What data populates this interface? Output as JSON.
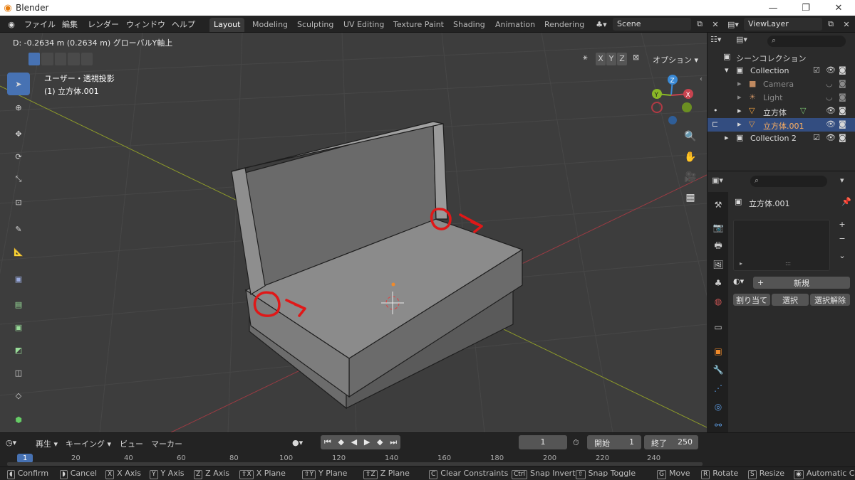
{
  "window": {
    "title": "Blender",
    "minimize": "—",
    "maximize": "❐",
    "close": "✕"
  },
  "menu": [
    "ファイル",
    "編集",
    "レンダー",
    "ウィンドウ",
    "ヘルプ"
  ],
  "workspaces": [
    "Layout",
    "Modeling",
    "Sculpting",
    "UV Editing",
    "Texture Paint",
    "Shading",
    "Animation",
    "Rendering"
  ],
  "active_workspace": "Layout",
  "scene": {
    "name": "Scene",
    "viewlayer": "ViewLayer"
  },
  "viewport": {
    "header_text": "D: -0.2634 m (0.2634 m) グローバルY軸上",
    "view_label": "ユーザー・透視投影",
    "object_label": "(1) 立方体.001",
    "axes": [
      "X",
      "Y",
      "Z"
    ],
    "options_label": "オプション"
  },
  "outliner": {
    "title": "シーンコレクション",
    "items": [
      {
        "label": "Collection",
        "level": 1,
        "icon": "collection-icon"
      },
      {
        "label": "Camera",
        "level": 2,
        "icon": "camera-icon",
        "dim": true
      },
      {
        "label": "Light",
        "level": 2,
        "icon": "light-icon",
        "dim": true
      },
      {
        "label": "立方体",
        "level": 2,
        "icon": "mesh-icon"
      },
      {
        "label": "立方体.001",
        "level": 2,
        "icon": "mesh-icon",
        "selected": true
      },
      {
        "label": "Collection 2",
        "level": 1,
        "icon": "collection-icon"
      }
    ]
  },
  "properties": {
    "object_name": "立方体.001",
    "new_label": "新規",
    "assign_label": "割り当て",
    "select_label": "選択",
    "deselect_label": "選択解除",
    "add_glyph": "+",
    "remove_glyph": "−",
    "dots": ":::"
  },
  "timeline": {
    "playback": "再生",
    "keying": "キーイング",
    "view": "ビュー",
    "marker": "マーカー",
    "current_frame": "1",
    "start_label": "開始",
    "start": "1",
    "end_label": "終了",
    "end": "250",
    "ticks": [
      "1",
      "20",
      "40",
      "60",
      "80",
      "100",
      "120",
      "140",
      "160",
      "180",
      "200",
      "220",
      "240"
    ]
  },
  "statusbar": [
    {
      "key": "",
      "label": "Confirm"
    },
    {
      "key": "",
      "label": "Cancel"
    },
    {
      "key": "X",
      "label": "X Axis"
    },
    {
      "key": "Y",
      "label": "Y Axis"
    },
    {
      "key": "Z",
      "label": "Z Axis"
    },
    {
      "key": "⇧X",
      "label": "X Plane"
    },
    {
      "key": "⇧Y",
      "label": "Y Plane"
    },
    {
      "key": "⇧Z",
      "label": "Z Plane"
    },
    {
      "key": "C",
      "label": "Clear Constraints"
    },
    {
      "key": "Ctrl",
      "label": "Snap Invert"
    },
    {
      "key": "⇧",
      "label": "Snap Toggle"
    },
    {
      "key": "G",
      "label": "Move"
    },
    {
      "key": "R",
      "label": "Rotate"
    },
    {
      "key": "S",
      "label": "Resize"
    },
    {
      "key": "",
      "label": "Automatic C"
    }
  ],
  "colors": {
    "accent": "#4772b3",
    "selected_row": "#334d80",
    "annotation": "#e01818",
    "axis_x": "#c8434f",
    "axis_y": "#8ab826",
    "axis_z": "#3a8ad6"
  }
}
